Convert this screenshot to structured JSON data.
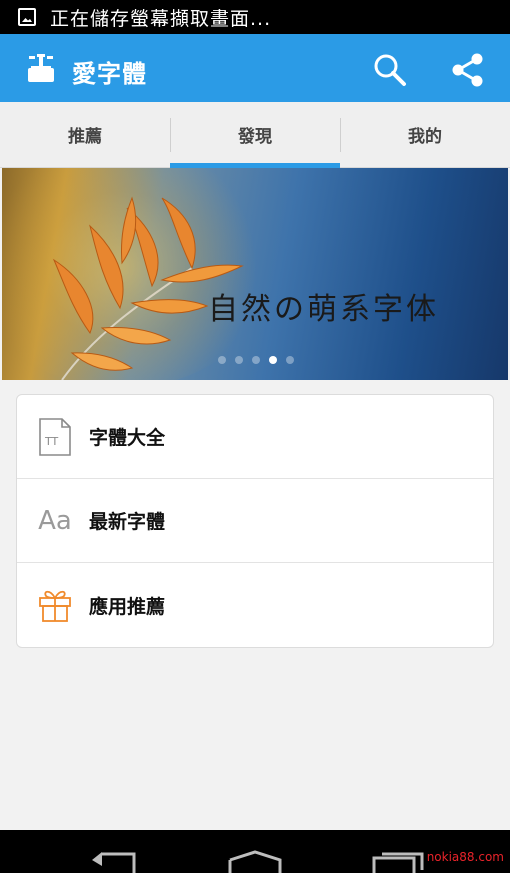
{
  "status_bar": {
    "text": "正在儲存螢幕擷取畫面..."
  },
  "app_bar": {
    "title": "愛字體"
  },
  "tabs": [
    {
      "label": "推薦"
    },
    {
      "label": "發現"
    },
    {
      "label": "我的"
    }
  ],
  "banner": {
    "caption": "自然の萌系字体",
    "pages": 5,
    "current_page": 4
  },
  "menu": [
    {
      "label": "字體大全",
      "icon": "font-file-icon",
      "glyph": "TT"
    },
    {
      "label": "最新字體",
      "icon": "font-aa-icon",
      "glyph": "Aa"
    },
    {
      "label": "應用推薦",
      "icon": "gift-icon"
    }
  ],
  "watermark": "nokia88.com",
  "colors": {
    "primary": "#2b9be6",
    "gift": "#f08a2c"
  }
}
